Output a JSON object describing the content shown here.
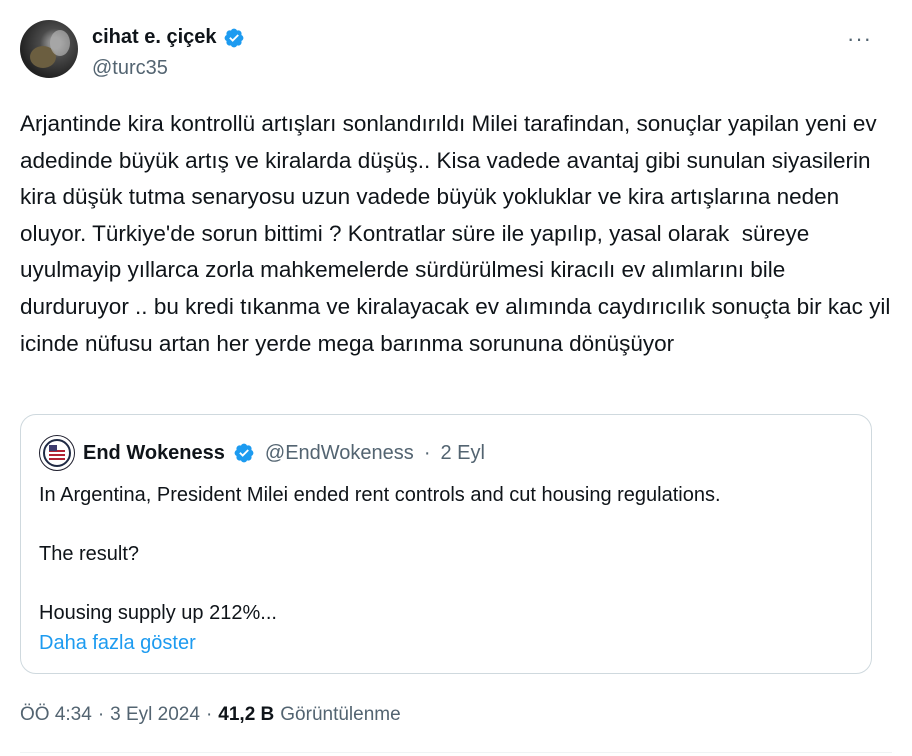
{
  "author": {
    "name": "cihat e. çiçek",
    "handle": "@turc35"
  },
  "menu": {
    "more_label": "···"
  },
  "tweet": {
    "text": "Arjantinde kira kontrollü artışları sonlandırıldı Milei tarafindan, sonuçlar yapilan yeni ev adedinde büyük artış ve kiralarda düşüş.. Kisa vadede avantaj gibi sunulan siyasilerin kira düşük tutma senaryosu uzun vadede büyük yokluklar ve kira artışlarına neden oluyor. Türkiye'de sorun bittimi ? Kontratlar süre ile yapılıp, yasal olarak  süreye uyulmayip yıllarca zorla mahkemelerde sürdürülmesi kiracılı ev alımlarını bile durduruyor .. bu kredi tıkanma ve kiralayacak ev alımında caydırıcılık sonuçta bir kac yil icinde nüfusu artan her yerde mega barınma sorununa dönüşüyor"
  },
  "quote": {
    "name": "End Wokeness",
    "handle": "@EndWokeness",
    "separator": "·",
    "date": "2 Eyl",
    "line1": "In Argentina, President Milei ended rent controls and cut housing regulations.",
    "line2": "The result?",
    "line3": "Housing supply up 212%...",
    "show_more": "Daha fazla göster"
  },
  "footer": {
    "time": "ÖÖ 4:34",
    "sep1": "·",
    "date": "3 Eyl 2024",
    "sep2": "·",
    "views_count": "41,2 B",
    "views_label": "Görüntülenme"
  },
  "colors": {
    "verified": "#1d9bf0",
    "link": "#1d9bf0",
    "secondary_text": "#536471",
    "primary_text": "#0f1419"
  },
  "icons": {
    "verified": "verified-badge-icon",
    "more": "more-horizontal-icon"
  }
}
